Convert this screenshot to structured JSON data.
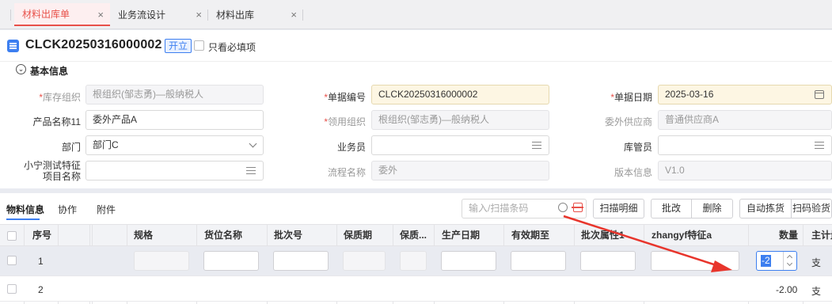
{
  "tabs": [
    {
      "label": "材料出库单",
      "close": "×"
    },
    {
      "label": "业务流设计",
      "close": "×"
    },
    {
      "label": "材料出库",
      "close": "×"
    }
  ],
  "header": {
    "doc_no": "CLCK20250316000002",
    "status": "开立",
    "required_only_label": "只看必填项"
  },
  "basic": {
    "section_title": "基本信息",
    "fields": {
      "inv_org_label": "库存组织",
      "inv_org_value": "根组织(邹志勇)—般纳税人",
      "doc_code_label": "单据编号",
      "doc_code_value": "CLCK20250316000002",
      "doc_date_label": "单据日期",
      "doc_date_value": "2025-03-16",
      "product_label": "产品名称11",
      "product_value": "委外产品A",
      "use_org_label": "领用组织",
      "use_org_value": "根组织(邹志勇)—般纳税人",
      "supplier_label": "委外供应商",
      "supplier_value": "普通供应商A",
      "dept_label": "部门",
      "dept_value": "部门C",
      "clerk_label": "业务员",
      "clerk_value": "",
      "keeper_label": "库管员",
      "keeper_value": "",
      "xnfeature_label_1": "小宁测试特征",
      "xnfeature_label_2": "项目名称",
      "xnfeature_value": "",
      "process_label": "流程名称",
      "process_value": "委外",
      "version_label": "版本信息",
      "version_value": "V1.0"
    }
  },
  "detail": {
    "subtabs": [
      "物料信息",
      "协作",
      "附件"
    ],
    "scan_placeholder": "输入/扫描条码",
    "buttons": [
      "扫描明细",
      "批改",
      "删除",
      "自动拣货",
      "扫码验货"
    ],
    "columns": [
      "序号",
      "规格",
      "货位名称",
      "批次号",
      "保质期",
      "保质...",
      "生产日期",
      "有效期至",
      "批次属性1",
      "zhangyf特征a",
      "数量",
      "主计量"
    ],
    "rows": [
      {
        "seq": "1",
        "qty": "-2",
        "unit": "支"
      },
      {
        "seq": "2",
        "qty": "-2.00",
        "unit": "支"
      }
    ]
  },
  "colors": {
    "accent": "#e8514a",
    "primary": "#3d7ff0"
  }
}
